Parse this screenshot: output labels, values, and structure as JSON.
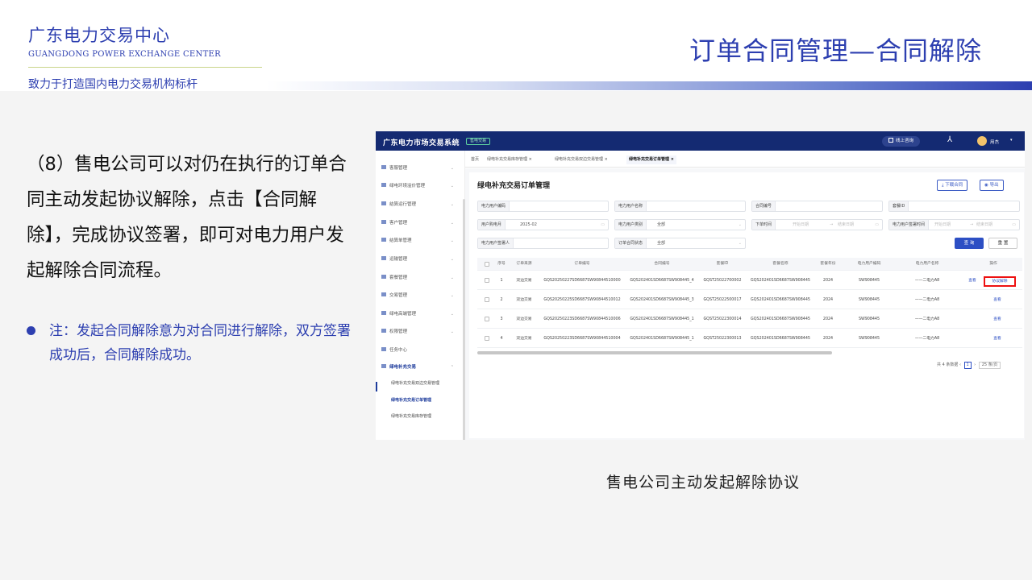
{
  "header": {
    "brand_cn": "广东电力交易中心",
    "brand_en": "GUANGDONG POWER EXCHANGE CENTER",
    "slogan": "致力于打造国内电力交易机构标杆",
    "title": "订单合同管理—合同解除"
  },
  "body": {
    "main_text": "（8）售电公司可以对仍在执行的订单合同主动发起协议解除，点击【合同解除】，完成协议签署，即可对电力用户发起解除合同流程。",
    "note": "注：发起合同解除意为对合同进行解除，双方签署成功后，合同解除成功。",
    "caption": "售电公司主动发起解除协议"
  },
  "colors": {
    "brand_blue": "#2d3fb0",
    "topbar": "#142a72",
    "highlight": "#e11111"
  },
  "app": {
    "system_title": "广东电力市场交易系统",
    "system_tag": "售电交易",
    "hotline": "线上咨询",
    "username": "用杰",
    "sidebar": [
      {
        "label": "客服管理",
        "icon": "headset-icon"
      },
      {
        "label": "绿电环境溢价管理",
        "icon": "leaf-icon"
      },
      {
        "label": "结算运行管理",
        "icon": "calc-icon"
      },
      {
        "label": "客户管理",
        "icon": "user-icon"
      },
      {
        "label": "结算单管理",
        "icon": "doc-icon"
      },
      {
        "label": "运输管理",
        "icon": "truck-icon"
      },
      {
        "label": "套餐管理",
        "icon": "box-icon"
      },
      {
        "label": "交易管理",
        "icon": "trade-icon"
      },
      {
        "label": "绿电高端管理",
        "icon": "chart-icon"
      },
      {
        "label": "权限管理",
        "icon": "lock-icon"
      },
      {
        "label": "任务中心",
        "icon": "task-icon"
      },
      {
        "label": "绿电补充交易",
        "icon": "menu-icon"
      }
    ],
    "sidebar_sub": [
      "绿电补充交易双边交易管理",
      "绿电补充交易订单管理",
      "绿电补充交易库存管理"
    ],
    "tabs": [
      "首页",
      "绿电补充交易库存管理 ×",
      "绿电补充交易双边交易管理 ×",
      "绿电补充交易订单管理 ×"
    ],
    "page_title": "绿电补充交易订单管理",
    "btn_download": "下载合同",
    "btn_export": "导出",
    "filters": {
      "user_code": "电力用户编码",
      "user_name": "电力用户名称",
      "contract_no": "合同编号",
      "package_id": "套餐ID",
      "month_label": "用户购电月",
      "month_value": "2025-02",
      "user_type_label": "电力用户类别",
      "user_type_value": "全部",
      "order_time": "下单时间",
      "sign_time": "电力用户签署时间",
      "date_start": "开始日期",
      "date_end": "结束日期",
      "signer": "电力用户签署人",
      "status_label": "订单合同状态",
      "status_value": "全部",
      "date_sep": "→"
    },
    "btn_query": "查 询",
    "btn_reset": "重 置",
    "columns": [
      "序号",
      "订单来源",
      "订单编号",
      "合同编号",
      "套餐ID",
      "套餐名称",
      "套餐年份",
      "电力用户编码",
      "电力用户名称",
      "操作"
    ],
    "rows": [
      {
        "no": "1",
        "source": "双边交易",
        "order": "GQS20250227SD6687SW90844510000",
        "contract": "GQS202401SD6687SW908445_4",
        "pkg_id": "GQST25022700002",
        "pkg_name": "GQS202401SD6687SW908445",
        "year": "2024",
        "code": "SW908445",
        "name": "——二电力A8",
        "view": "查看",
        "terminate": "协议解除"
      },
      {
        "no": "2",
        "source": "双边交易",
        "order": "GQS20250225SD6687SW90844510012",
        "contract": "GQS202401SD6687SW908445_3",
        "pkg_id": "GQST25022500017",
        "pkg_name": "GQS202401SD6687SW908445",
        "year": "2024",
        "code": "SW908445",
        "name": "——二电力A8",
        "view": "查看"
      },
      {
        "no": "3",
        "source": "双边交易",
        "order": "GQS20250223SD6687SW90844510006",
        "contract": "GQS202401SD6687SW908445_1",
        "pkg_id": "GQST25022300014",
        "pkg_name": "GQS202401SD6687SW908445",
        "year": "2024",
        "code": "SW908445",
        "name": "——二电力A8",
        "view": "查看"
      },
      {
        "no": "4",
        "source": "双边交易",
        "order": "GQS20250223SD6687SW90844510004",
        "contract": "GQS202401SD6687SW908445_1",
        "pkg_id": "GQST25022300013",
        "pkg_name": "GQS202401SD6687SW908445",
        "year": "2024",
        "code": "SW908445",
        "name": "——二电力A8",
        "view": "查看"
      }
    ],
    "pager": {
      "total": "共 4 条数据",
      "page": "1",
      "size": "25 条/页"
    }
  }
}
